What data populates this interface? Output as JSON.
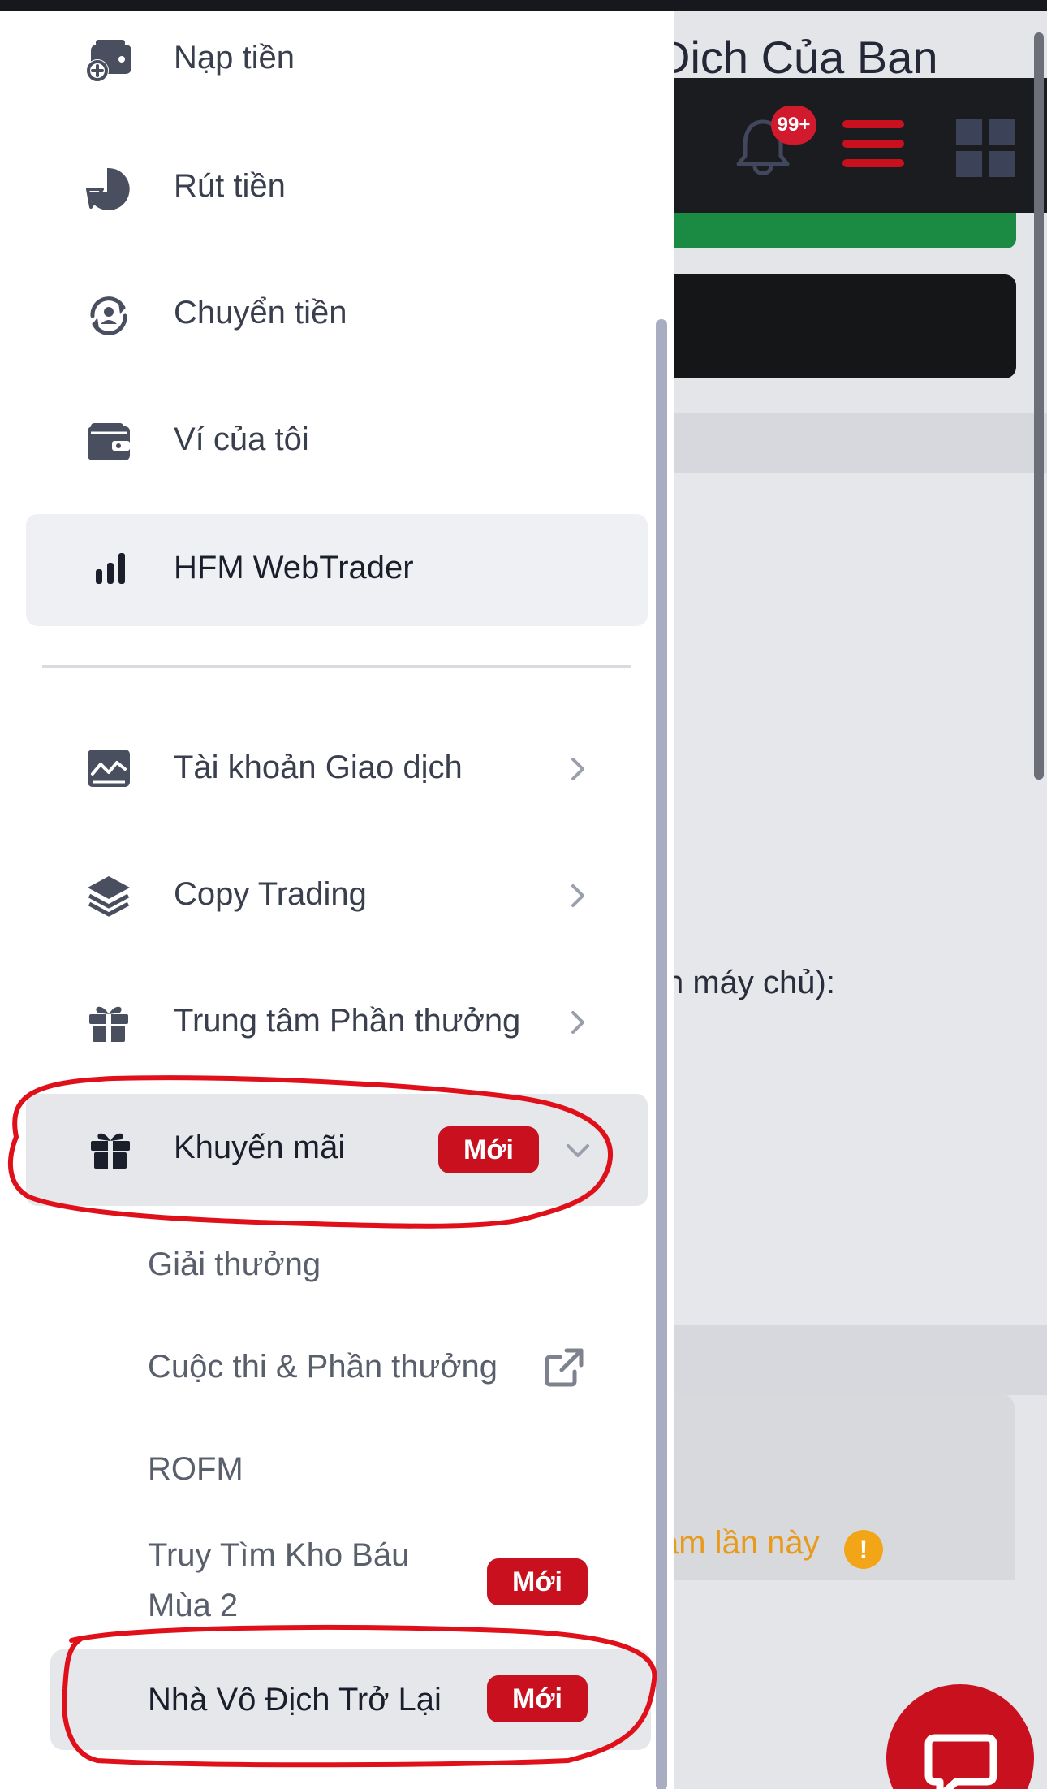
{
  "background": {
    "page_title": "Dich Của Ban",
    "notification_badge": "99+",
    "server_text": "n máy chủ):",
    "warning_text": "ám lần này",
    "warning_icon_char": "!"
  },
  "drawer": {
    "items": [
      {
        "label": "Nạp tiền",
        "icon": "deposit-icon"
      },
      {
        "label": "Rút tiền",
        "icon": "withdraw-icon"
      },
      {
        "label": "Chuyển tiền",
        "icon": "transfer-icon"
      },
      {
        "label": "Ví của tôi",
        "icon": "wallet-icon"
      },
      {
        "label": "HFM WebTrader",
        "icon": "bar-chart-icon"
      },
      {
        "label": "Tài khoản Giao dịch",
        "icon": "trading-account-icon"
      },
      {
        "label": "Copy Trading",
        "icon": "layers-icon"
      },
      {
        "label": "Trung tâm Phần thưởng",
        "icon": "gift-icon"
      },
      {
        "label": "Khuyến mãi",
        "icon": "gift-icon",
        "badge": "Mới"
      }
    ],
    "sub_items": [
      {
        "label": "Giải thưởng"
      },
      {
        "label": "Cuộc thi & Phần thưởng",
        "icon": "external-link-icon"
      },
      {
        "label": "ROFM"
      },
      {
        "label_line1": "Truy Tìm Kho Báu",
        "label_line2": "Mùa 2",
        "badge": "Mới"
      },
      {
        "label": "Nhà Vô Địch Trở Lại",
        "badge": "Mới"
      }
    ]
  },
  "colors": {
    "accent_red": "#c8101f",
    "annotation_red": "#e0101a",
    "green_bar": "#1b8a43",
    "warning_orange": "#e89a1d"
  }
}
